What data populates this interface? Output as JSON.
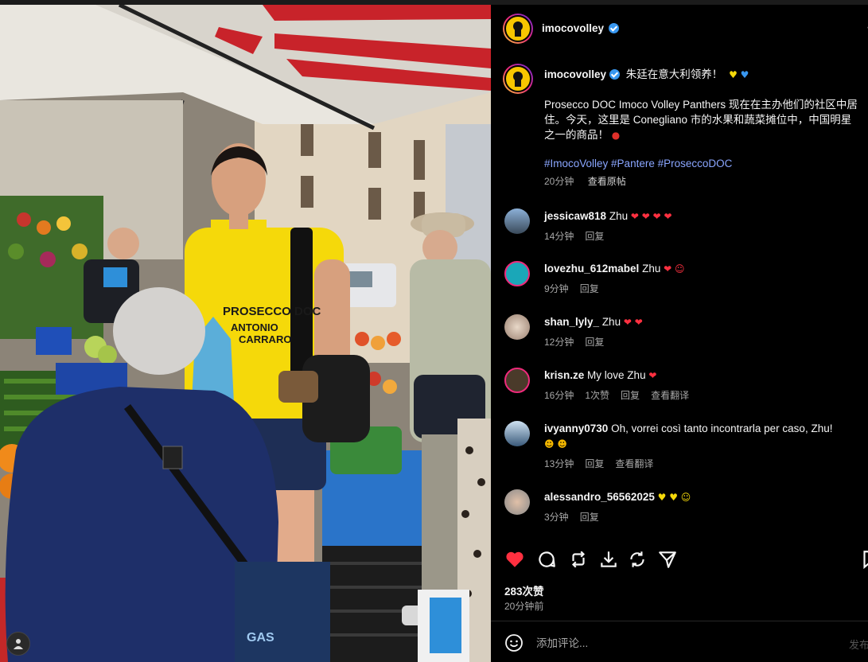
{
  "post": {
    "account": "imocovolley",
    "caption_title": "朱廷在意大利领养！",
    "caption_body": "Prosecco DOC Imoco Volley Panthers 现在在主办他们的社区中居住。今天，这里是 Conegliano 市的水果和蔬菜摊位中，中国明星之一的商品！",
    "hashtags": "#ImocoVolley #Pantere #ProseccoDOC",
    "time": "20分钟",
    "see_original": "查看原帖",
    "likes": "283次赞",
    "posted_ago": "20分钟前",
    "comment_placeholder": "添加评论...",
    "post_button": "发布"
  },
  "comments": [
    {
      "user": "jessicaw818",
      "text": "Zhu",
      "emoji": "❤ ❤ ❤ ❤",
      "time": "14分钟",
      "reply": "回复",
      "likes": "",
      "translate": ""
    },
    {
      "user": "lovezhu_612mabel",
      "text": "Zhu",
      "emoji": "❤ ☺",
      "time": "9分钟",
      "reply": "回复",
      "likes": "",
      "translate": ""
    },
    {
      "user": "shan_lyly_",
      "text": "Zhu",
      "emoji": "❤ ❤",
      "time": "12分钟",
      "reply": "回复",
      "likes": "",
      "translate": ""
    },
    {
      "user": "krisn.ze",
      "text": "My love Zhu",
      "emoji": "❤",
      "time": "16分钟",
      "likes": "1次赞",
      "reply": "回复",
      "translate": "查看翻译"
    },
    {
      "user": "ivyanny0730",
      "text": "Oh, vorrei così tanto incontrarla per caso, Zhu!",
      "emoji": "☻ ☻",
      "time": "13分钟",
      "reply": "回复",
      "likes": "",
      "translate": "查看翻译"
    },
    {
      "user": "alessandro_56562025",
      "text": "",
      "emoji": "♥ ♥ ☺",
      "time": "3分钟",
      "reply": "回复",
      "likes": "",
      "translate": ""
    }
  ],
  "photo_text": {
    "shirt_line1": "PROSECCO DOC",
    "shirt_line2": "ANTONIO",
    "shirt_line3": "CARRARO"
  },
  "colors": {
    "heart": "#ff3040",
    "verified": "#3897f0",
    "hashtag": "#8aa6ff",
    "shirt": "#f5d90a"
  },
  "icons": {
    "like": "heart-icon",
    "comment": "comment-icon",
    "repost": "repost-icon",
    "download": "download-icon",
    "remix": "remix-icon",
    "share": "send-icon",
    "save": "bookmark-icon",
    "emoji": "emoji-icon"
  }
}
